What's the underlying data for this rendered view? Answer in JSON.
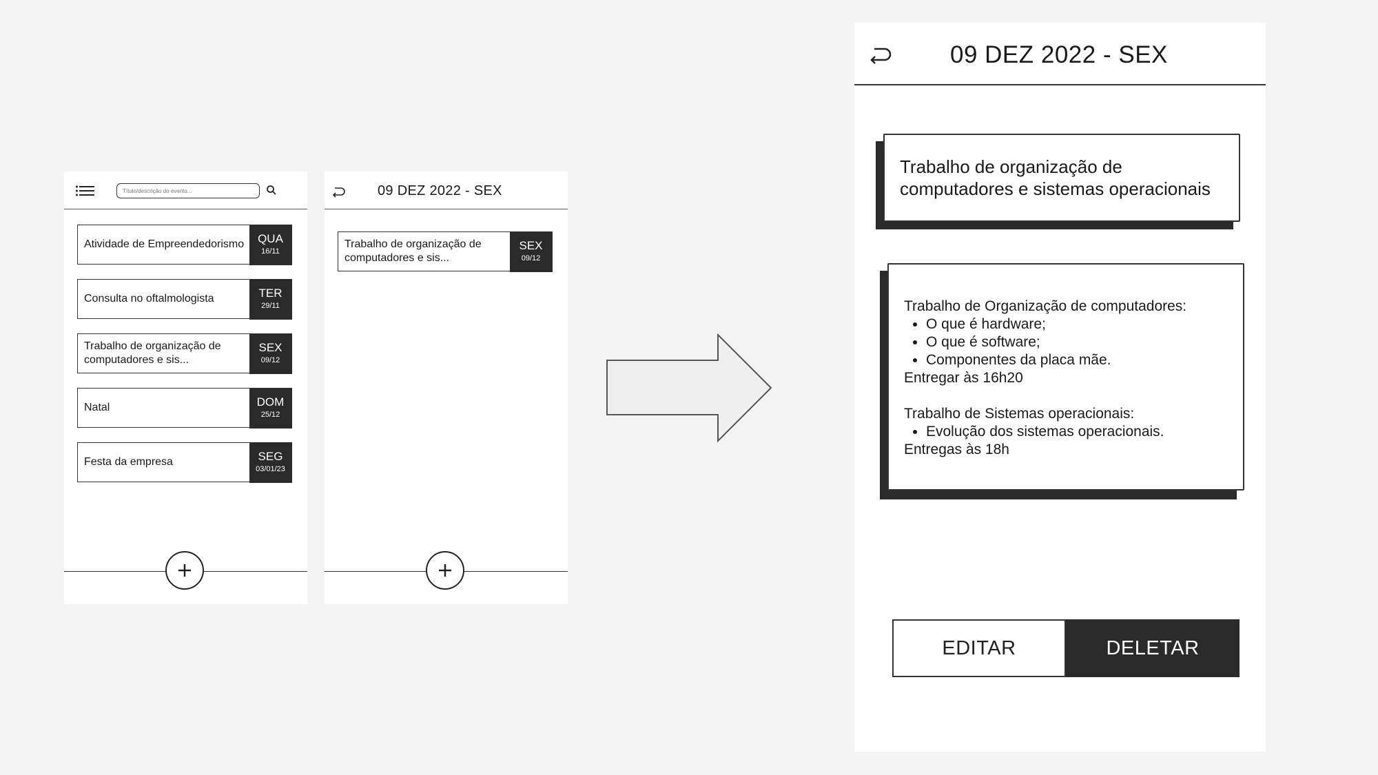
{
  "list_screen": {
    "search_placeholder": "Título/descrição do evento...",
    "events": [
      {
        "title": "Atividade de Empreendedorismo",
        "weekday": "QUA",
        "date": "16/11"
      },
      {
        "title": "Consulta no oftalmologista",
        "weekday": "TER",
        "date": "29/11"
      },
      {
        "title": "Trabalho de organização de computadores e sis...",
        "weekday": "SEX",
        "date": "09/12"
      },
      {
        "title": "Natal",
        "weekday": "DOM",
        "date": "25/12"
      },
      {
        "title": "Festa da empresa",
        "weekday": "SEG",
        "date": "03/01/23"
      }
    ],
    "add_label": "+"
  },
  "day_screen": {
    "title": "09 DEZ 2022 - SEX",
    "events": [
      {
        "title": "Trabalho de organização de computadores e sis...",
        "weekday": "SEX",
        "date": "09/12"
      }
    ],
    "add_label": "+"
  },
  "detail_screen": {
    "title": "09 DEZ 2022 - SEX",
    "event_title": "Trabalho de organização de computadores e sistemas operacionais",
    "description": {
      "section1_heading": "Trabalho de Organização de computadores:",
      "section1_items": [
        "O que é hardware;",
        "O que é software;",
        "Componentes da placa mãe."
      ],
      "section1_footer": "Entregar às 16h20",
      "section2_heading": "Trabalho de Sistemas operacionais:",
      "section2_items": [
        "Evolução dos sistemas operacionais."
      ],
      "section2_footer": "Entregas às 18h"
    },
    "edit_label": "EDITAR",
    "delete_label": "DELETAR"
  },
  "icons": [
    "menu-icon",
    "search-icon",
    "back-icon",
    "plus-icon",
    "right-arrow-icon"
  ],
  "colors": {
    "background": "#f4f4f4",
    "screen": "#ffffff",
    "dark": "#2a2a2a",
    "arrow_fill": "#efefef"
  }
}
